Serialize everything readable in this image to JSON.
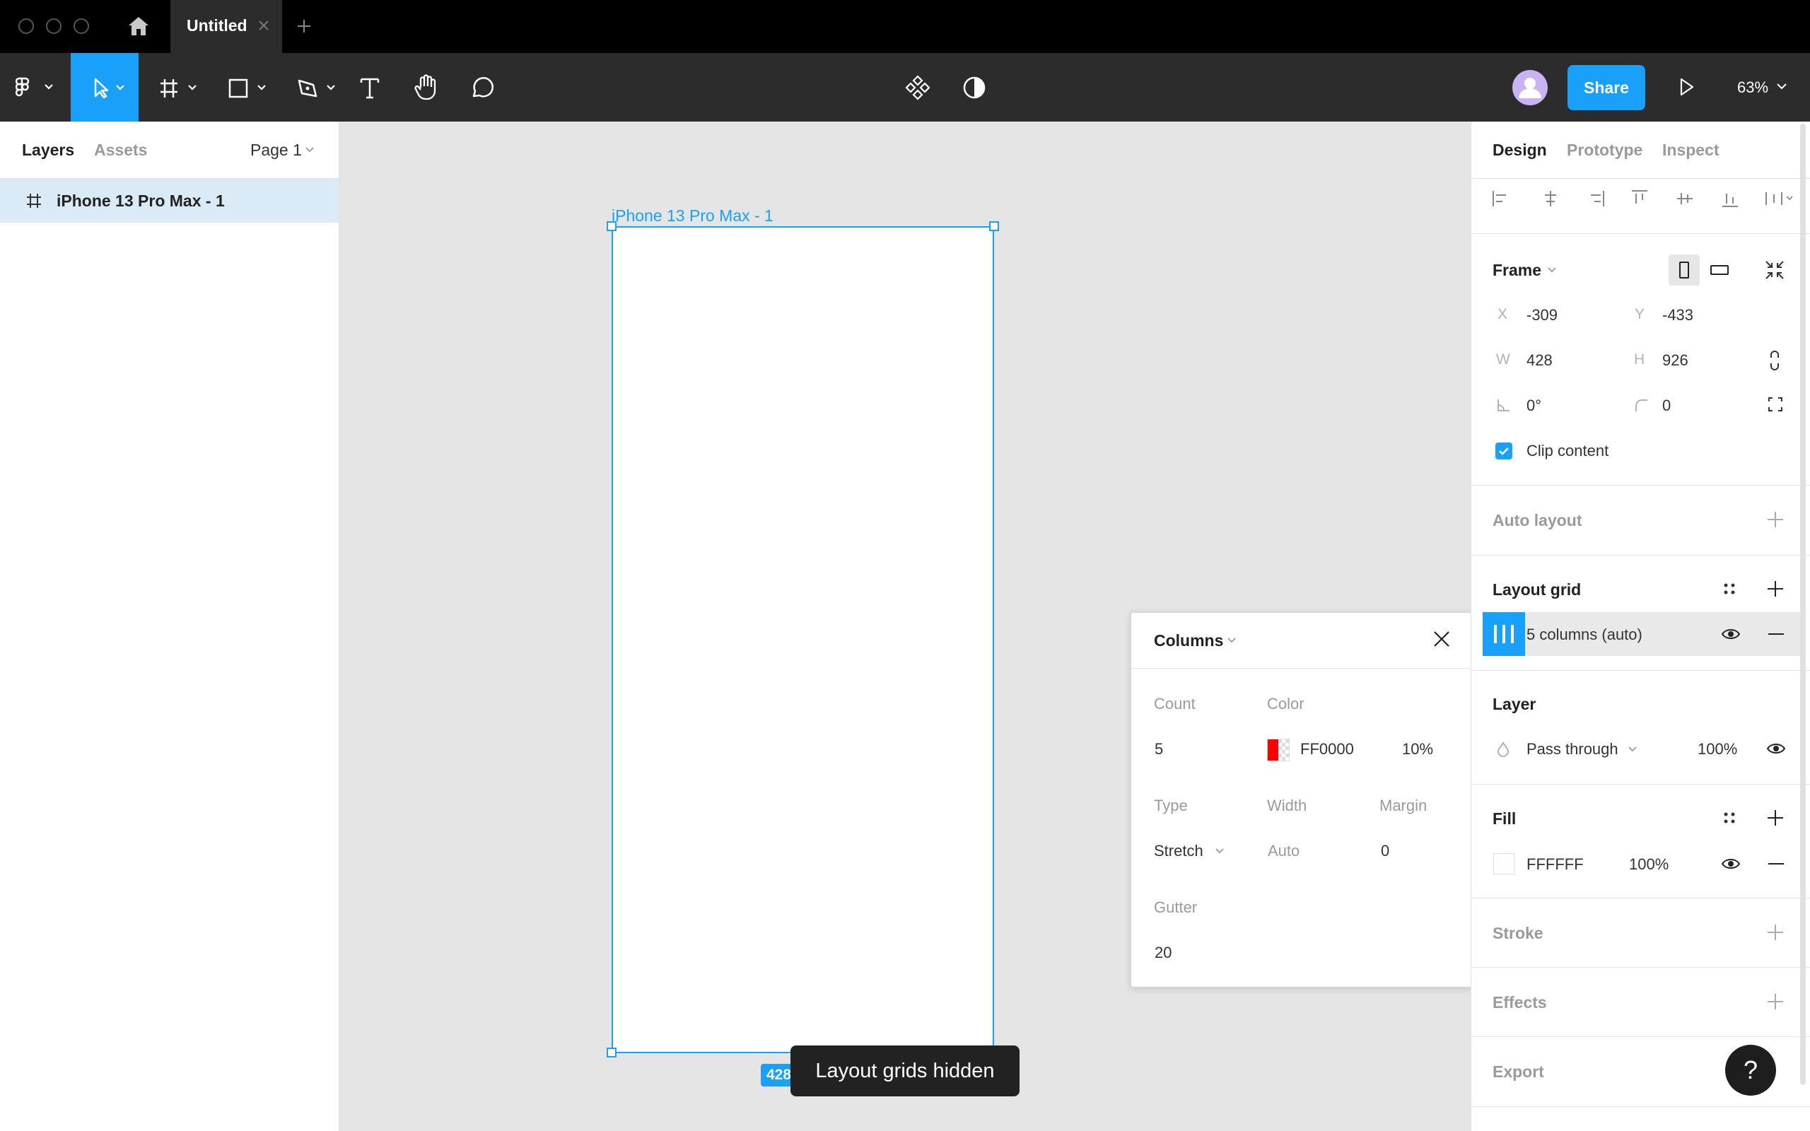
{
  "window": {
    "tab_title": "Untitled"
  },
  "toolbar": {
    "share_label": "Share",
    "zoom": "63%"
  },
  "left_panel": {
    "tabs": [
      "Layers",
      "Assets"
    ],
    "page_select": "Page 1",
    "layers": [
      {
        "name": "iPhone 13 Pro Max - 1"
      }
    ]
  },
  "canvas": {
    "frame_label": "iPhone 13 Pro Max - 1",
    "size_badge": "428",
    "toast": "Layout grids hidden"
  },
  "grid_popup": {
    "title": "Columns",
    "count_label": "Count",
    "count": "5",
    "color_label": "Color",
    "color_hex": "FF0000",
    "color_opacity": "10%",
    "type_label": "Type",
    "type_value": "Stretch",
    "width_label": "Width",
    "width_value": "Auto",
    "margin_label": "Margin",
    "margin_value": "0",
    "gutter_label": "Gutter",
    "gutter_value": "20",
    "swatch_color": "#ff0000"
  },
  "right_panel": {
    "tabs": [
      "Design",
      "Prototype",
      "Inspect"
    ],
    "frame": {
      "title": "Frame",
      "x_label": "X",
      "x": "-309",
      "y_label": "Y",
      "y": "-433",
      "w_label": "W",
      "w": "428",
      "h_label": "H",
      "h": "926",
      "rotation": "0°",
      "radius": "0",
      "clip_label": "Clip content"
    },
    "auto_layout": "Auto layout",
    "layout_grid": {
      "title": "Layout grid",
      "item": "5 columns (auto)"
    },
    "layer": {
      "title": "Layer",
      "blend": "Pass through",
      "opacity": "100%"
    },
    "fill": {
      "title": "Fill",
      "hex": "FFFFFF",
      "opacity": "100%"
    },
    "stroke": "Stroke",
    "effects": "Effects",
    "export": "Export"
  },
  "help": "?",
  "colors": {
    "accent": "#18a0fb",
    "toolbar": "#2c2c2c",
    "titlebar": "#000000"
  }
}
